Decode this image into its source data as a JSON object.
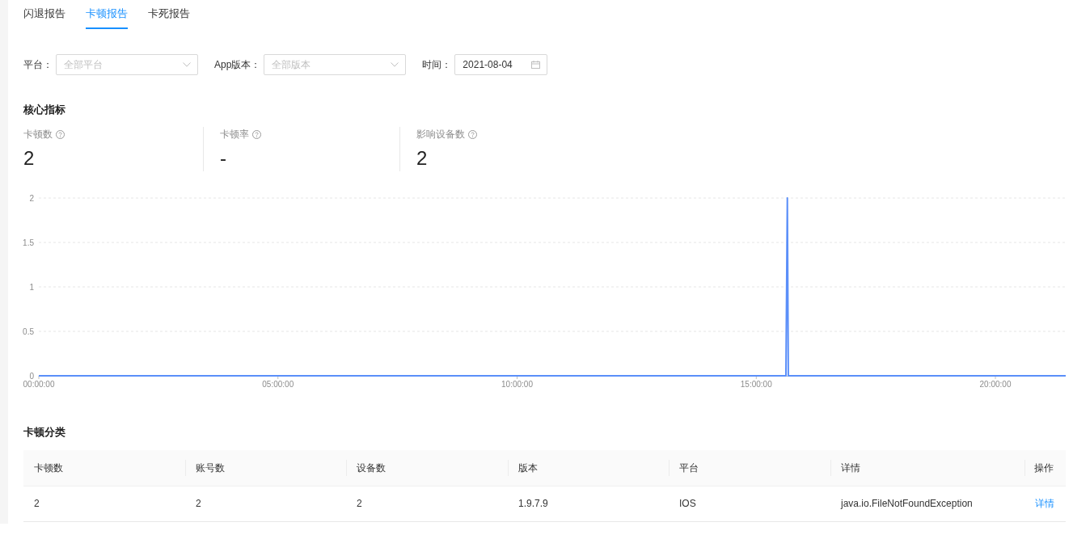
{
  "tabs": [
    {
      "label": "闪退报告",
      "selected": false
    },
    {
      "label": "卡顿报告",
      "selected": true
    },
    {
      "label": "卡死报告",
      "selected": false
    }
  ],
  "filters": [
    {
      "kind": "select",
      "label": "平台：",
      "placeholder": "全部平台"
    },
    {
      "kind": "select",
      "label": "App版本：",
      "placeholder": "全部版本"
    },
    {
      "kind": "date",
      "label": "时间：",
      "value": "2021-08-04"
    }
  ],
  "core_metrics": {
    "title": "核心指标",
    "items": [
      {
        "label": "卡顿数",
        "value": "2"
      },
      {
        "label": "卡顿率",
        "value": "-"
      },
      {
        "label": "影响设备数",
        "value": "2"
      }
    ],
    "chart_data": {
      "type": "line",
      "x": [
        0,
        15.62,
        15.65,
        15.67,
        21.47
      ],
      "series": [
        {
          "color": "#5b8ff9",
          "values": [
            0,
            0,
            2,
            0,
            0
          ]
        }
      ],
      "xlim": [
        0,
        21.47
      ],
      "ylim": [
        0,
        2
      ],
      "xticks": [
        {
          "value": 0,
          "label": "00:00:00"
        },
        {
          "value": 5,
          "label": "05:00:00"
        },
        {
          "value": 10,
          "label": "10:00:00"
        },
        {
          "value": 15,
          "label": "15:00:00"
        },
        {
          "value": 20,
          "label": "20:00:00"
        }
      ],
      "yticks": [
        0,
        0.5,
        1,
        1.5,
        2
      ],
      "grid": true
    }
  },
  "classification": {
    "title": "卡顿分类",
    "columns": [
      "卡顿数",
      "账号数",
      "设备数",
      "版本",
      "平台",
      "详情",
      "操作"
    ],
    "rows": [
      {
        "cells": [
          "2",
          "2",
          "2",
          "1.9.7.9",
          "IOS",
          "java.io.FileNotFoundException"
        ],
        "action": "详情"
      }
    ]
  }
}
